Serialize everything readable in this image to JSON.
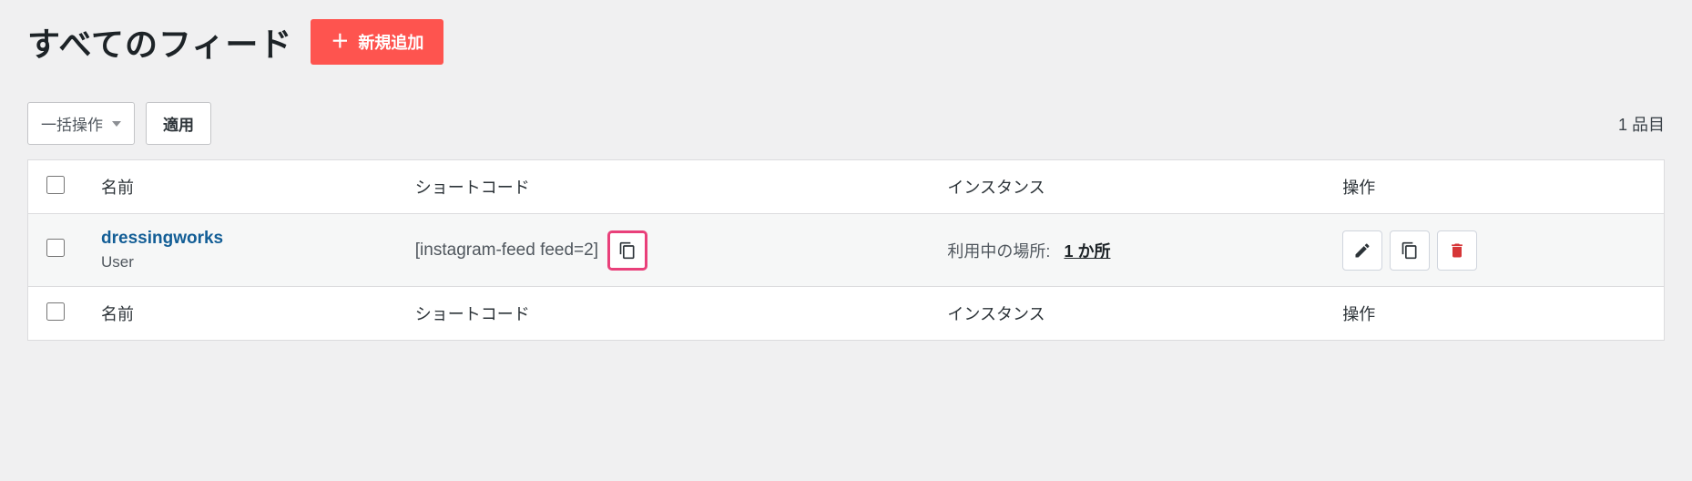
{
  "header": {
    "title": "すべてのフィード",
    "add_new_label": "新規追加"
  },
  "controls": {
    "bulk_action_label": "一括操作",
    "apply_label": "適用",
    "item_count": "1 品目"
  },
  "table": {
    "columns": {
      "name": "名前",
      "shortcode": "ショートコード",
      "instance": "インスタンス",
      "actions": "操作"
    },
    "rows": [
      {
        "name": "dressingworks",
        "subtype": "User",
        "shortcode": "[instagram-feed feed=2]",
        "instance_label": "利用中の場所:",
        "instance_count": "1 か所"
      }
    ]
  }
}
